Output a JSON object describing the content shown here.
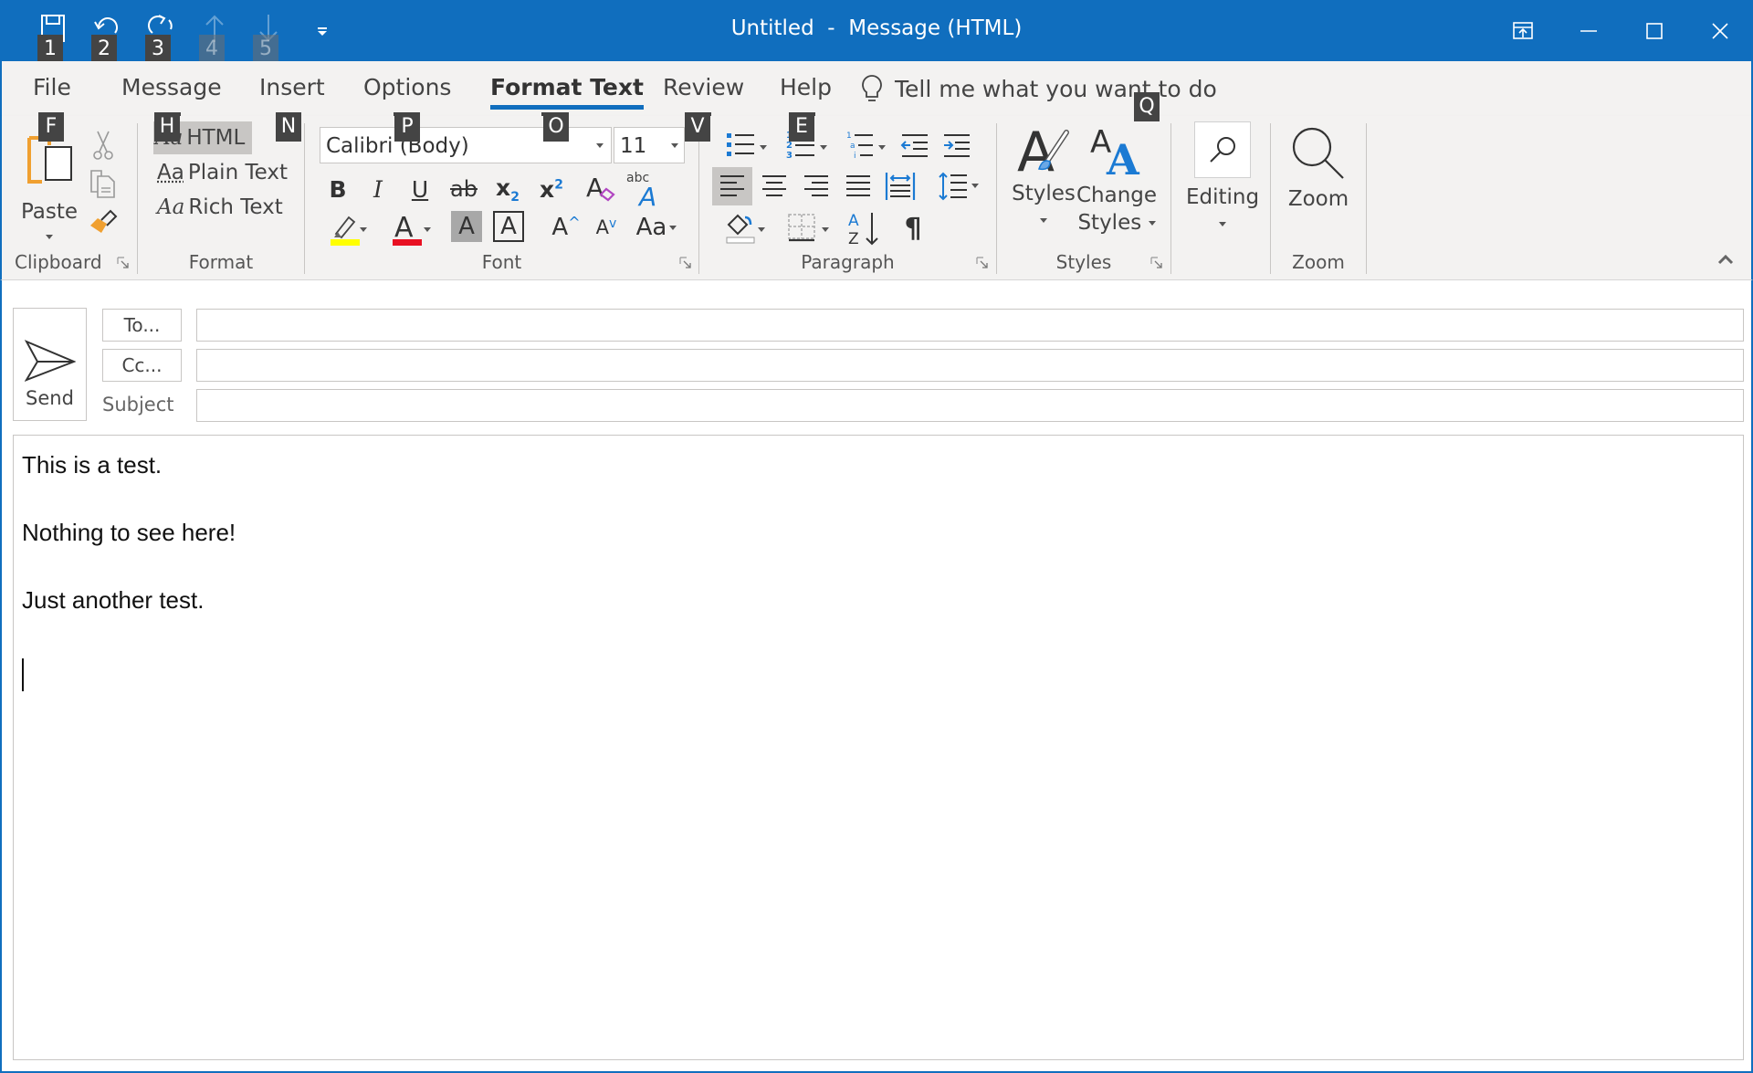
{
  "window": {
    "title": "Untitled  -  Message (HTML)",
    "accent_color": "#106ebe",
    "controls": [
      {
        "name": "ribbon-display-options-button",
        "icon": "ribbon-display-icon"
      },
      {
        "name": "minimize-button",
        "icon": "minimize-icon"
      },
      {
        "name": "maximize-button",
        "icon": "maximize-icon"
      },
      {
        "name": "close-button",
        "icon": "close-icon"
      }
    ]
  },
  "quick_access": [
    {
      "name": "save",
      "icon": "save-icon",
      "keytip": "1",
      "enabled": true
    },
    {
      "name": "undo",
      "icon": "undo-icon",
      "keytip": "2",
      "enabled": true
    },
    {
      "name": "redo",
      "icon": "redo-icon",
      "keytip": "3",
      "enabled": true
    },
    {
      "name": "previous-item",
      "icon": "arrow-up-icon",
      "keytip": "4",
      "enabled": false
    },
    {
      "name": "next-item",
      "icon": "arrow-down-icon",
      "keytip": "5",
      "enabled": false
    },
    {
      "name": "customize",
      "icon": "customize-qat-icon"
    }
  ],
  "tabs": [
    {
      "label": "File",
      "keytip": "F"
    },
    {
      "label": "Message",
      "keytip": "H"
    },
    {
      "label": "Insert",
      "keytip": "N"
    },
    {
      "label": "Options",
      "keytip": "P"
    },
    {
      "label": "Format Text",
      "keytip": "O",
      "active": true
    },
    {
      "label": "Review",
      "keytip": "V"
    },
    {
      "label": "Help",
      "keytip": "E"
    }
  ],
  "tell_me": {
    "text": "Tell me what you want to do",
    "keytip": "Q",
    "icon": "lightbulb-icon"
  },
  "ribbon": {
    "clipboard": {
      "label": "Clipboard",
      "paste_label": "Paste",
      "buttons": [
        "cut",
        "copy",
        "format-painter"
      ]
    },
    "format": {
      "label": "Format",
      "options": [
        {
          "prefix": "Aa",
          "label": "HTML",
          "selected": true
        },
        {
          "prefix": "Aa",
          "label": "Plain Text",
          "selected": false
        },
        {
          "prefix": "Aa",
          "label": "Rich Text",
          "selected": false
        }
      ]
    },
    "font": {
      "label": "Font",
      "font_name": "Calibri (Body)",
      "font_size": "11",
      "highlight_color": "#ffff00",
      "font_color": "#e81123",
      "buttons": [
        "bold",
        "italic",
        "underline",
        "strikethrough",
        "subscript",
        "superscript",
        "clear-formatting",
        "text-effects",
        "text-highlight-color",
        "font-color",
        "character-shading",
        "character-border",
        "grow-font",
        "shrink-font",
        "change-case"
      ],
      "glyphs": {
        "bold": "B",
        "italic": "I",
        "underline": "U",
        "strike": "ab",
        "sub": "x",
        "sup": "x",
        "sub_num": "2",
        "sup_num": "2",
        "shade": "A",
        "border": "A",
        "grow": "A",
        "shrink": "A",
        "case": "Aa",
        "abc": "abc",
        "effects": "A",
        "clear": "A"
      }
    },
    "paragraph": {
      "label": "Paragraph",
      "buttons": [
        "bullets",
        "numbering",
        "multilevel-list",
        "decrease-indent",
        "increase-indent",
        "align-left",
        "center",
        "align-right",
        "justify",
        "distributed",
        "line-spacing",
        "shading",
        "borders",
        "sort",
        "show-hide-marks"
      ],
      "active_alignment": "align-left",
      "sort_glyph_a": "A",
      "sort_glyph_z": "Z",
      "pilcrow": "¶"
    },
    "styles": {
      "label": "Styles",
      "styles_label": "Styles",
      "change_styles_line1": "Change",
      "change_styles_line2": "Styles"
    },
    "editing": {
      "label": "Editing"
    },
    "zoom": {
      "label": "Zoom",
      "button_label": "Zoom"
    }
  },
  "compose": {
    "send_label": "Send",
    "to_label": "To...",
    "cc_label": "Cc...",
    "subject_label": "Subject",
    "to_value": "",
    "cc_value": "",
    "subject_value": "",
    "body_lines": [
      "This is a test.",
      "",
      "Nothing to see here!",
      "",
      "Just another test.",
      ""
    ]
  }
}
